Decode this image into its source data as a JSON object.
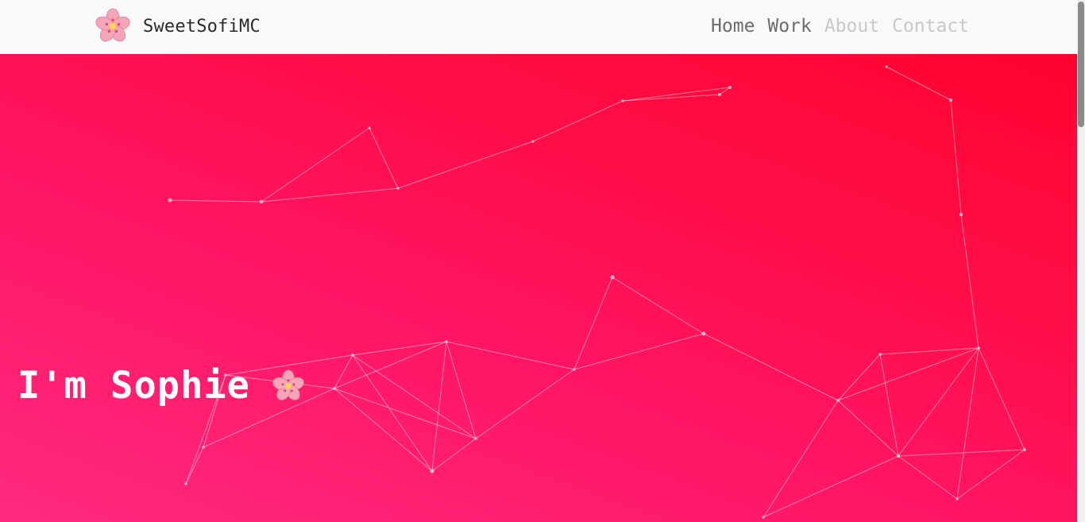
{
  "brand": {
    "name": "SweetSofiMC",
    "icon": "cherry-blossom-icon"
  },
  "nav": {
    "items": [
      {
        "label": "Home"
      },
      {
        "label": "Work"
      },
      {
        "label": "About"
      },
      {
        "label": "Contact"
      }
    ]
  },
  "hero": {
    "headline": "I'm Sophie",
    "headline_icon": "cherry-blossom-icon",
    "background": [
      "#ff2a7f",
      "#ff0330"
    ]
  },
  "colors": {
    "accent": "#ff1565",
    "navbar_bg": "#f8f9fa"
  }
}
